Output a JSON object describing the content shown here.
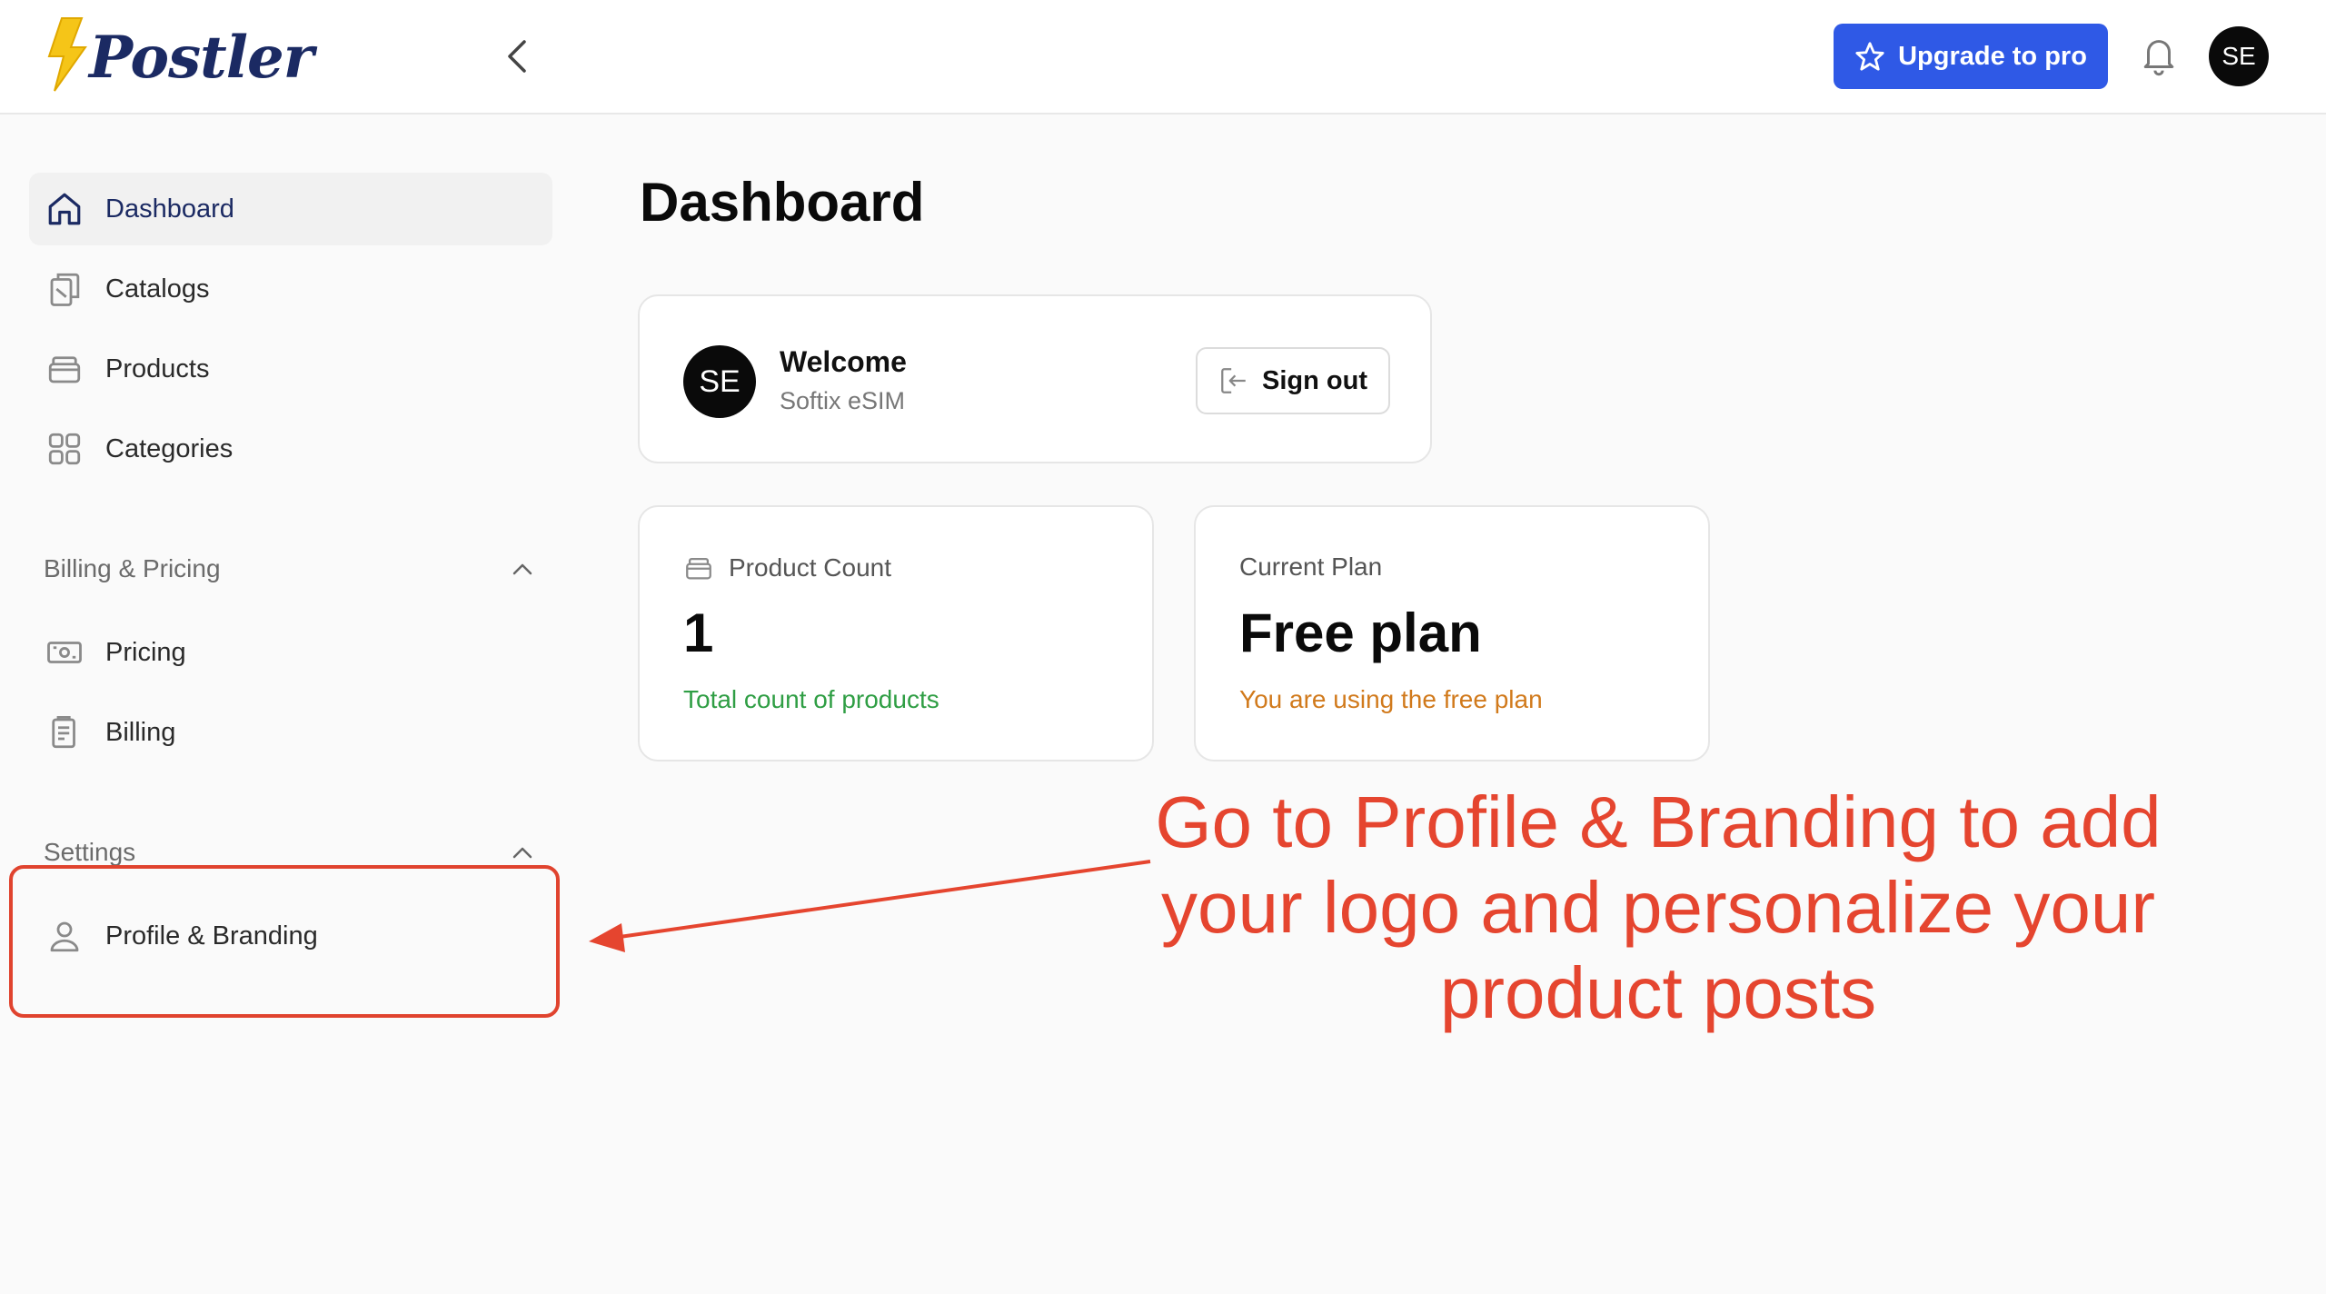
{
  "header": {
    "logo_text": "Postler",
    "upgrade_label": "Upgrade to pro",
    "avatar_initials": "SE"
  },
  "sidebar": {
    "items": [
      {
        "label": "Dashboard",
        "icon": "home-icon"
      },
      {
        "label": "Catalogs",
        "icon": "catalog-icon"
      },
      {
        "label": "Products",
        "icon": "box-icon"
      },
      {
        "label": "Categories",
        "icon": "grid-icon"
      }
    ],
    "billing_section": {
      "title": "Billing & Pricing",
      "items": [
        {
          "label": "Pricing",
          "icon": "banknote-icon"
        },
        {
          "label": "Billing",
          "icon": "receipt-icon"
        }
      ]
    },
    "settings_section": {
      "title": "Settings",
      "items": [
        {
          "label": "Profile & Branding",
          "icon": "user-icon"
        }
      ]
    }
  },
  "main": {
    "title": "Dashboard",
    "welcome": {
      "avatar_initials": "SE",
      "title": "Welcome",
      "subtitle": "Softix eSIM",
      "signout_label": "Sign out"
    },
    "product_count": {
      "label": "Product Count",
      "value": "1",
      "note": "Total count of products"
    },
    "current_plan": {
      "label": "Current Plan",
      "value": "Free plan",
      "note": "You are using the free plan"
    }
  },
  "annotation": {
    "text": "Go to Profile & Branding to add your logo and personalize your product posts"
  },
  "colors": {
    "accent": "#2f59e6",
    "brand_navy": "#1b2a63",
    "annotation_red": "#e5452f",
    "success_green": "#2f9e44",
    "plan_orange": "#d17a1c"
  }
}
